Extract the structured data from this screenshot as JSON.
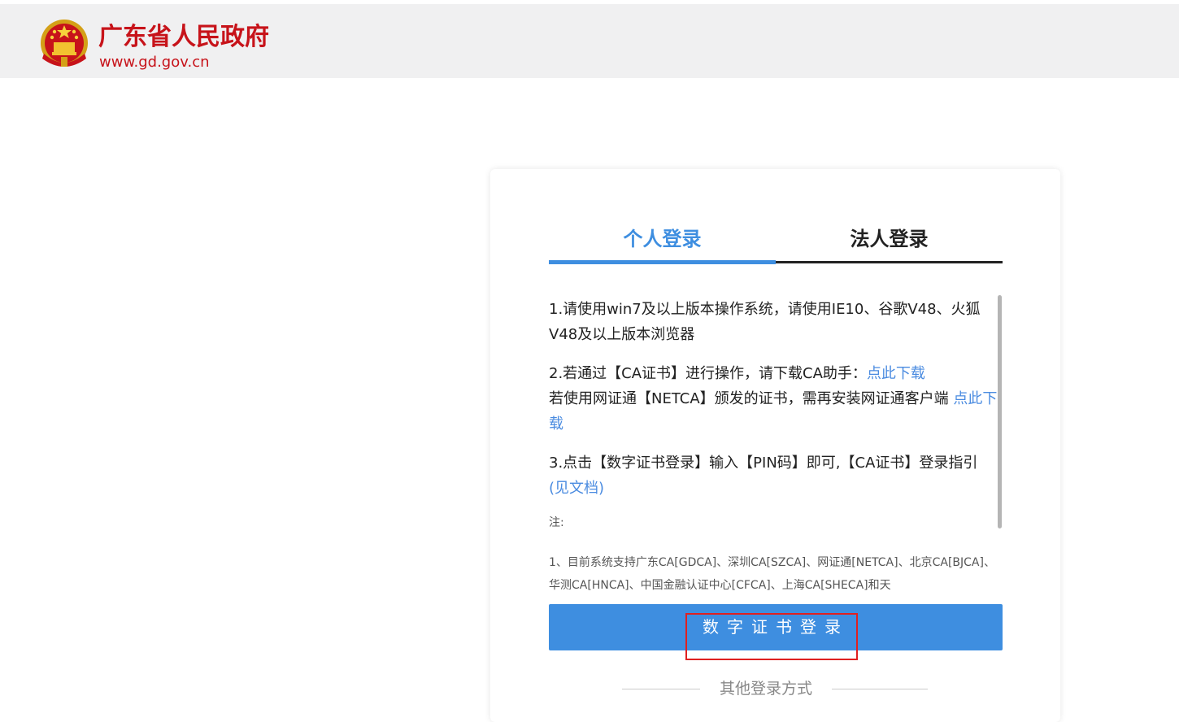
{
  "header": {
    "site_name": "广东省人民政府",
    "site_url": "www.gd.gov.cn",
    "emblem_icon": "national-emblem-icon"
  },
  "tabs": [
    {
      "label": "个人登录",
      "active": true
    },
    {
      "label": "法人登录",
      "active": false
    }
  ],
  "instructions": {
    "item1": "1.请使用win7及以上版本操作系统，请使用IE10、谷歌V48、火狐V48及以上版本浏览器",
    "item2_prefix": "2.若通过【CA证书】进行操作，请下载CA助手：",
    "item2_link": "点此下载",
    "item2_line2_prefix": "若使用网证通【NETCA】颁发的证书，需再安装网证通客户端",
    "item2_line2_link": "点此下载",
    "item3_prefix": "3.点击【数字证书登录】输入【PIN码】即可,【CA证书】登录指引",
    "item3_link": "(见文档)",
    "note_title": "注:",
    "note_line1": "1、目前系统支持广东CA[GDCA]、深圳CA[SZCA]、网证通[NETCA]、北京CA[BJCA]、华测CA[HNCA]、中国金融认证中心[CFCA]、上海CA[SHECA]和天"
  },
  "login_button": "数字证书登录",
  "other_login": "其他登录方式",
  "colors": {
    "accent": "#3e8ee0",
    "brand_red": "#c7131a",
    "link": "#4a8be0",
    "annotation": "#e02020"
  }
}
